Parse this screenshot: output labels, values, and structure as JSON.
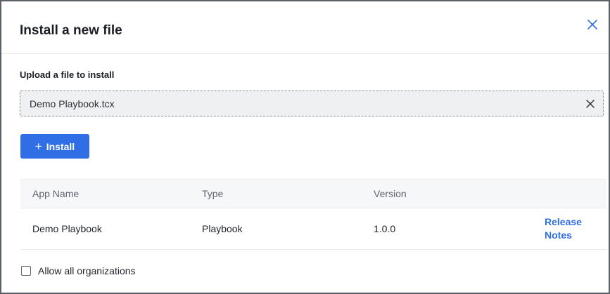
{
  "dialog": {
    "title": "Install a new file",
    "close_icon": "close-icon"
  },
  "upload": {
    "label": "Upload a file to install",
    "file_name": "Demo Playbook.tcx",
    "clear_icon": "clear-icon"
  },
  "install_button": {
    "icon": "plus-icon",
    "icon_glyph": "+",
    "label": "Install"
  },
  "table": {
    "headers": [
      "App Name",
      "Type",
      "Version",
      ""
    ],
    "rows": [
      {
        "app_name": "Demo Playbook",
        "type": "Playbook",
        "version": "1.0.0",
        "link": "Release Notes"
      }
    ]
  },
  "footer": {
    "checkbox_label": "Allow all organizations",
    "checkbox_checked": false
  },
  "colors": {
    "accent": "#2f6ee5",
    "dialog_border": "#5b5f66",
    "field_bg": "#eff0f2"
  }
}
